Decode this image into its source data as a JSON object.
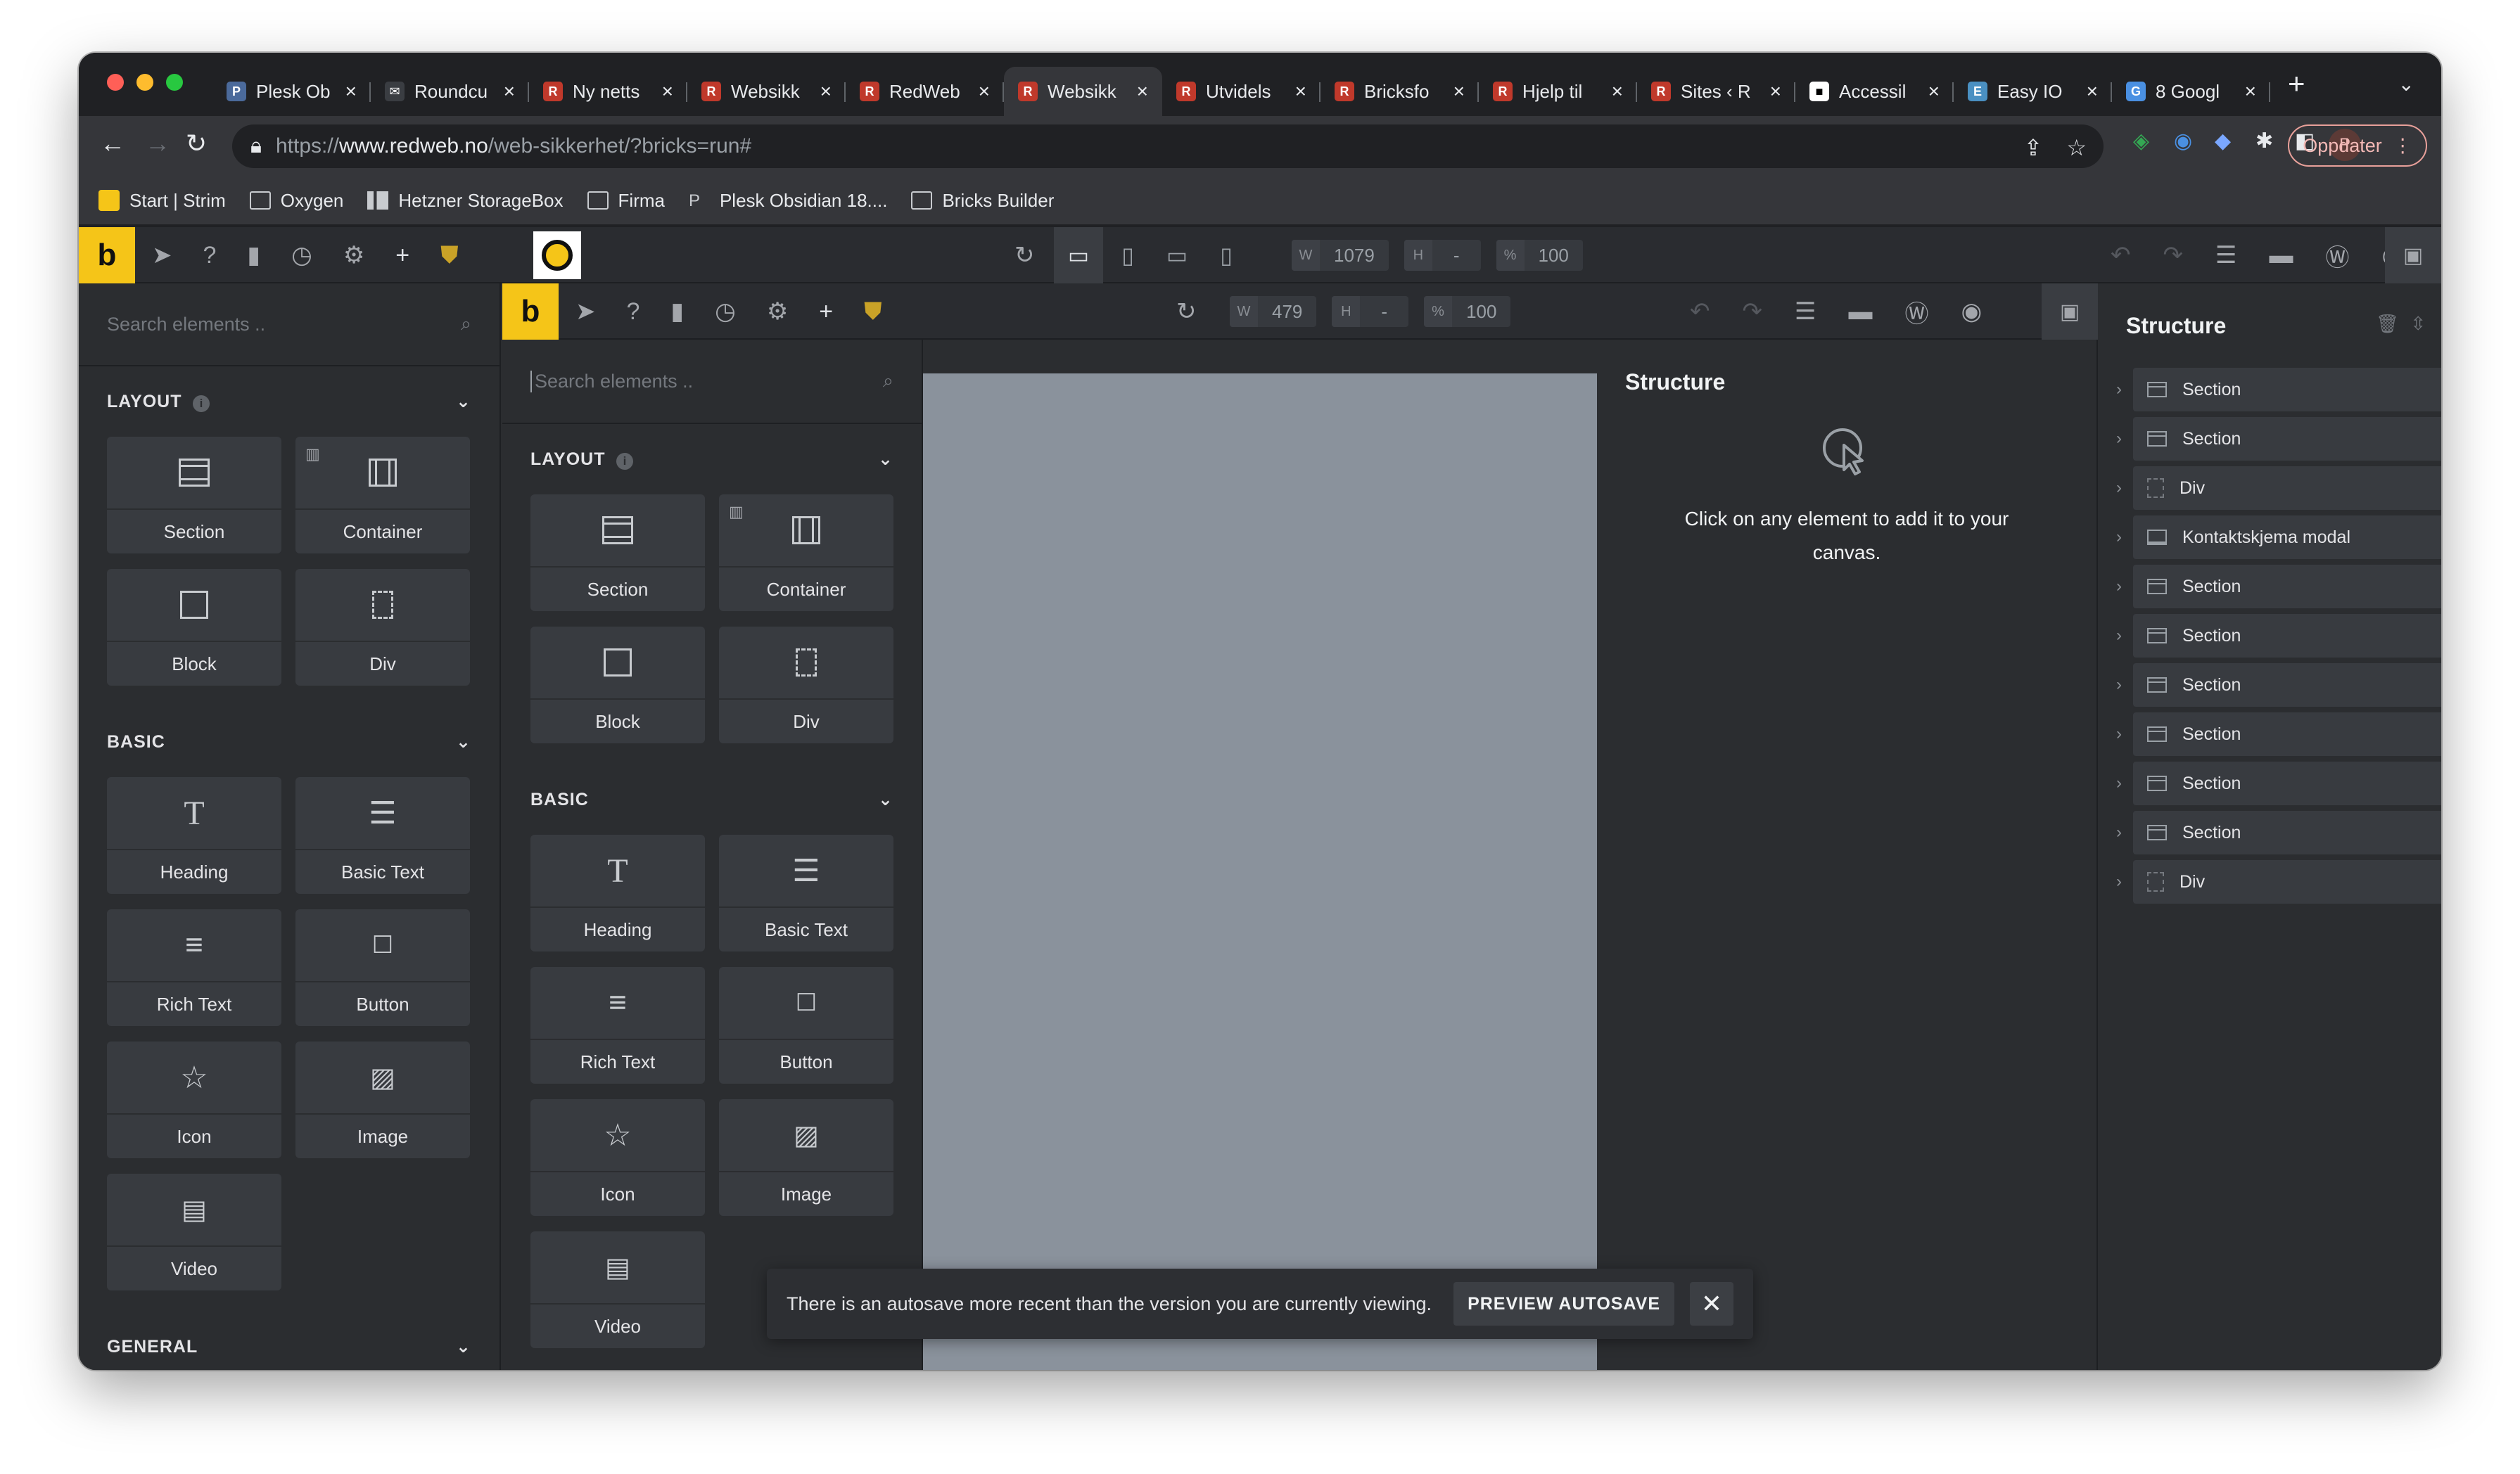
{
  "browser": {
    "tabs": [
      {
        "title": "Plesk Ob",
        "favicon": "P",
        "color": "#4b6a9b"
      },
      {
        "title": "Roundcu",
        "favicon": "✉",
        "color": "#3a3d42"
      },
      {
        "title": "Ny netts",
        "favicon": "R",
        "color": "#c0392b"
      },
      {
        "title": "Websikk",
        "favicon": "R",
        "color": "#c0392b"
      },
      {
        "title": "RedWeb",
        "favicon": "R",
        "color": "#c0392b"
      },
      {
        "title": "Websikk",
        "favicon": "R",
        "color": "#c0392b"
      },
      {
        "title": "Utvidels",
        "favicon": "R",
        "color": "#c0392b"
      },
      {
        "title": "Bricksfo",
        "favicon": "R",
        "color": "#c0392b"
      },
      {
        "title": "Hjelp til",
        "favicon": "R",
        "color": "#c0392b"
      },
      {
        "title": "Sites ‹ R",
        "favicon": "R",
        "color": "#c0392b"
      },
      {
        "title": "Accessil",
        "favicon": "■",
        "color": "#ffffff"
      },
      {
        "title": "Easy IO",
        "favicon": "E",
        "color": "#4a90c2"
      },
      {
        "title": "8 Googl",
        "favicon": "G",
        "color": "#4a90e2"
      }
    ],
    "active_tab_index": 5,
    "url_prefix": "https://",
    "url_host": "www.redweb.no",
    "url_path": "/web-sikkerhet/?bricks=run#",
    "profile_initial": "P",
    "update_label": "Oppdater",
    "bookmarks": [
      {
        "label": "Start | Strim",
        "icon": "yellow-play-icon"
      },
      {
        "label": "Oxygen",
        "icon": "folder-icon"
      },
      {
        "label": "Hetzner StorageBox",
        "icon": "chart-icon"
      },
      {
        "label": "Firma",
        "icon": "folder-icon"
      },
      {
        "label": "Plesk Obsidian 18....",
        "icon": "plesk-icon"
      },
      {
        "label": "Bricks Builder",
        "icon": "folder-icon"
      }
    ]
  },
  "builder": {
    "logo": "b",
    "outer": {
      "width": "1079",
      "height": "-",
      "zoom": "100",
      "w_key": "W",
      "h_key": "H",
      "zoom_key": "%"
    },
    "inner": {
      "width": "479",
      "height": "-",
      "zoom": "100",
      "w_key": "W",
      "h_key": "H",
      "zoom_key": "%"
    },
    "search_placeholder": "Search elements ..",
    "categories": {
      "layout": "LAYOUT",
      "basic": "BASIC",
      "general": "GENERAL"
    },
    "layout_elements": [
      "Section",
      "Container",
      "Block",
      "Div"
    ],
    "basic_elements": [
      "Heading",
      "Basic Text",
      "Rich Text",
      "Button",
      "Icon",
      "Image",
      "Video"
    ],
    "inner_structure": {
      "title": "Structure",
      "empty_message": "Click on any element to add it to your canvas."
    },
    "structure": {
      "title": "Structure",
      "items": [
        {
          "label": "Section",
          "type": "section"
        },
        {
          "label": "Section",
          "type": "section"
        },
        {
          "label": "Div",
          "type": "div"
        },
        {
          "label": "Kontaktskjema modal",
          "type": "modal"
        },
        {
          "label": "Section",
          "type": "section"
        },
        {
          "label": "Section",
          "type": "section"
        },
        {
          "label": "Section",
          "type": "section"
        },
        {
          "label": "Section",
          "type": "section"
        },
        {
          "label": "Section",
          "type": "section"
        },
        {
          "label": "Section",
          "type": "section"
        },
        {
          "label": "Div",
          "type": "div"
        }
      ]
    },
    "toast": {
      "message": "There is an autosave more recent than the version you are currently viewing.",
      "button": "PREVIEW AUTOSAVE"
    }
  }
}
